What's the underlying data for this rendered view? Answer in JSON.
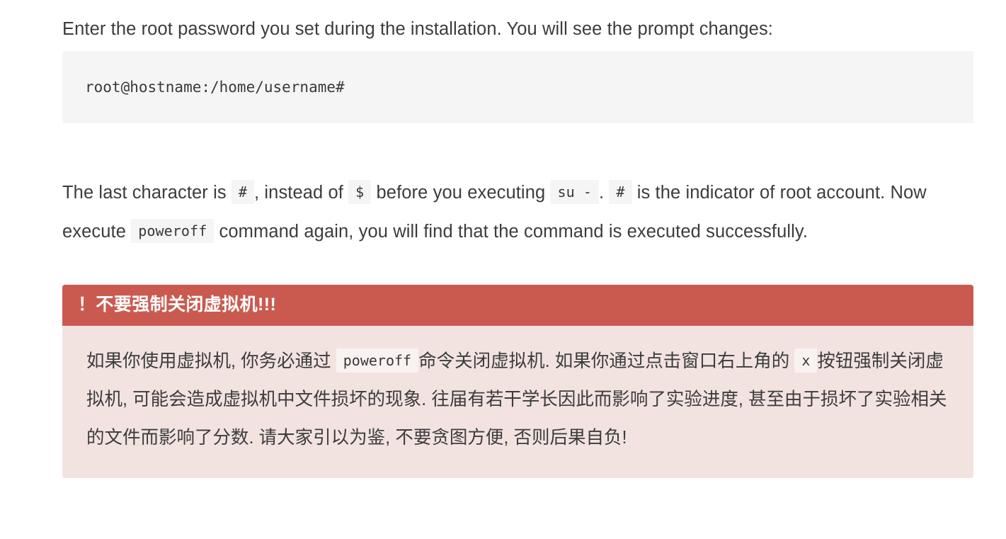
{
  "document": {
    "intro_paragraph": "Enter the root password you set during the installation. You will see the prompt changes:",
    "code_block": {
      "content": "root@hostname:/home/username#",
      "language": "shell"
    },
    "explanation": {
      "seg1": "The last character is",
      "code1": "#",
      "seg2": ", instead of",
      "code2": "$",
      "seg3": "before you executing",
      "code3": "su -",
      "seg4": ".",
      "code4": "#",
      "seg5": "is the indicator of root account. Now execute",
      "code5": "poweroff",
      "seg6": "command again, you will find that the command is executed successfully."
    },
    "admonition": {
      "type": "danger",
      "title": "！不要强制关闭虚拟机!!!",
      "title_background": "#ca5a50",
      "body_background": "#f2e3e1",
      "body": {
        "seg1": "如果你使用虚拟机, 你务必通过",
        "code1": "poweroff",
        "seg2": "命令关闭虚拟机. 如果你通过点击窗口右上角的",
        "code2": "x",
        "seg3": "按钮强制关闭虚拟机, 可能会造成虚拟机中文件损坏的现象. 往届有若干学长因此而影响了实验进度, 甚至由于损坏了实验相关的文件而影响了分数. 请大家引以为鉴, 不要贪图方便, 否则后果自负!"
      }
    }
  }
}
